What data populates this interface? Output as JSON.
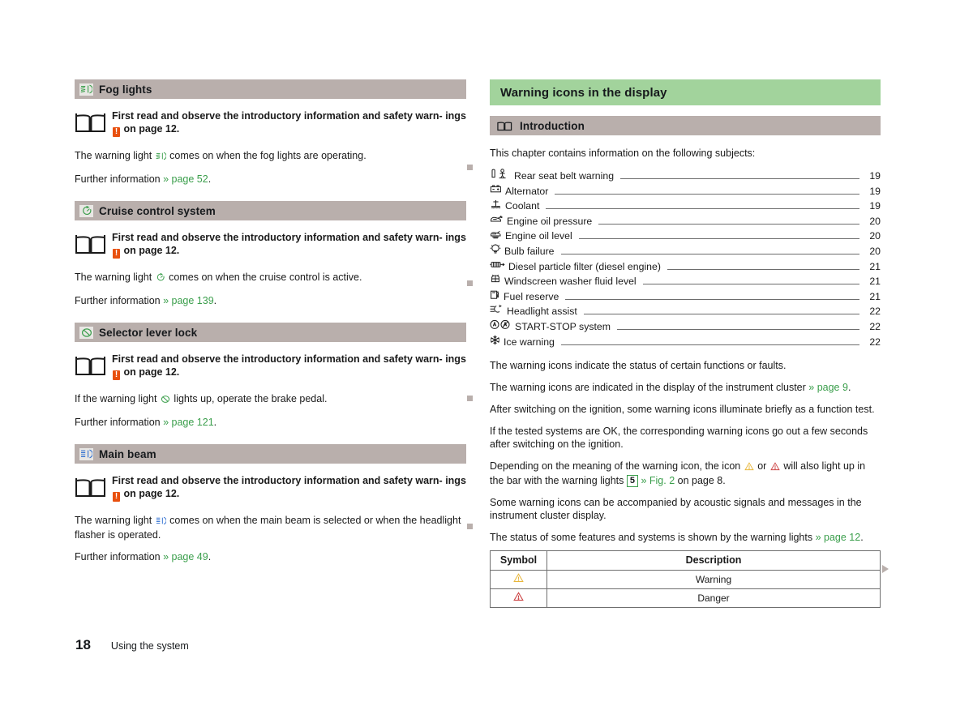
{
  "left_column": {
    "sections": [
      {
        "id": "fog-lights",
        "icon": "fog-light-icon",
        "title": "Fog lights",
        "note": {
          "prefix": "First read and observe the introductory information and safety warn-",
          "mid": "ings",
          "badge": "!",
          "suffix": "on page 12."
        },
        "body_before": "The warning light",
        "body_icon": "fog-light-icon",
        "body_after": "comes on when the fog lights are operating.",
        "further_label": "Further information",
        "further_link": "» page 52",
        "further_end": "."
      },
      {
        "id": "cruise-control-system",
        "icon": "cruise-control-icon",
        "title": "Cruise control system",
        "note": {
          "prefix": "First read and observe the introductory information and safety warn-",
          "mid": "ings",
          "badge": "!",
          "suffix": "on page 12."
        },
        "body_before": "The warning light",
        "body_icon": "cruise-control-icon",
        "body_after": "comes on when the cruise control is active.",
        "further_label": "Further information",
        "further_link": "» page 139",
        "further_end": "."
      },
      {
        "id": "selector-lever-lock",
        "icon": "selector-lever-lock-icon",
        "title": "Selector lever lock",
        "note": {
          "prefix": "First read and observe the introductory information and safety warn-",
          "mid": "ings",
          "badge": "!",
          "suffix": "on page 12."
        },
        "body_before": "If the warning light",
        "body_icon": "selector-lever-lock-icon",
        "body_after": "lights up, operate the brake pedal.",
        "further_label": "Further information",
        "further_link": "» page 121",
        "further_end": "."
      },
      {
        "id": "main-beam",
        "icon": "main-beam-icon",
        "title": "Main beam",
        "note": {
          "prefix": "First read and observe the introductory information and safety warn-",
          "mid": "ings",
          "badge": "!",
          "suffix": "on page 12."
        },
        "body_before": "The warning light",
        "body_icon": "main-beam-icon",
        "body_after": "comes on when the main beam is selected or when the headlight flasher is operated.",
        "further_label": "Further information",
        "further_link": "» page 49",
        "further_end": "."
      }
    ]
  },
  "right_column": {
    "chapter_title": "Warning icons in the display",
    "subsection_title": "Introduction",
    "subsection_icon": "book-icon",
    "intro_line": "This chapter contains information on the following subjects:",
    "toc": [
      {
        "icon": "rear-seat-belt-icon",
        "label": "Rear seat belt warning",
        "page": "19"
      },
      {
        "icon": "alternator-icon",
        "label": "Alternator",
        "page": "19"
      },
      {
        "icon": "coolant-icon",
        "label": "Coolant",
        "page": "19"
      },
      {
        "icon": "engine-oil-pressure-icon",
        "label": "Engine oil pressure",
        "page": "20"
      },
      {
        "icon": "engine-oil-level-icon",
        "label": "Engine oil level",
        "page": "20"
      },
      {
        "icon": "bulb-failure-icon",
        "label": "Bulb failure",
        "page": "20"
      },
      {
        "icon": "diesel-particle-filter-icon",
        "label": "Diesel particle filter (diesel engine)",
        "page": "21"
      },
      {
        "icon": "windscreen-washer-icon",
        "label": "Windscreen washer fluid level",
        "page": "21"
      },
      {
        "icon": "fuel-reserve-icon",
        "label": "Fuel reserve",
        "page": "21"
      },
      {
        "icon": "headlight-assist-icon",
        "label": "Headlight assist",
        "page": "22"
      },
      {
        "icon": "start-stop-icon",
        "label": "START-STOP system",
        "page": "22"
      },
      {
        "icon": "ice-warning-icon",
        "label": "Ice warning",
        "page": "22"
      }
    ],
    "paragraphs": {
      "p1": "The warning icons indicate the status of certain functions or faults.",
      "p2_before": "The warning icons are indicated in the display of the instrument cluster",
      "p2_link": "» page 9",
      "p2_end": ".",
      "p3": "After switching on the ignition, some warning icons illuminate briefly as a function test.",
      "p4": "If the tested systems are OK, the corresponding warning icons go out a few seconds after switching on the ignition.",
      "p5_a": "Depending on the meaning of the warning icon, the icon",
      "p5_or": "or",
      "p5_b": "will also light up in the bar with the warning lights",
      "p5_framed": "5",
      "p5_figlink": "» Fig. 2",
      "p5_c": "on page 8.",
      "p6": "Some warning icons can be accompanied by acoustic signals and messages in the instrument cluster display.",
      "p7_a": "The status of some features and systems is shown by the warning lights",
      "p7_link": "» page 12",
      "p7_end": "."
    },
    "table": {
      "headers": [
        "Symbol",
        "Description"
      ],
      "rows": [
        {
          "symbol": "warning-triangle-yellow-icon",
          "description": "Warning"
        },
        {
          "symbol": "danger-triangle-red-icon",
          "description": "Danger"
        }
      ]
    }
  },
  "footer": {
    "page_number": "18",
    "chapter": "Using the system"
  },
  "colors": {
    "chapter_bar_green": "#a2d39c",
    "section_bar_gray": "#b9afac",
    "link_green": "#3a9e4b",
    "badge_orange": "#e8500f",
    "warning_yellow": "#e8b63a",
    "danger_red": "#cc4444"
  }
}
